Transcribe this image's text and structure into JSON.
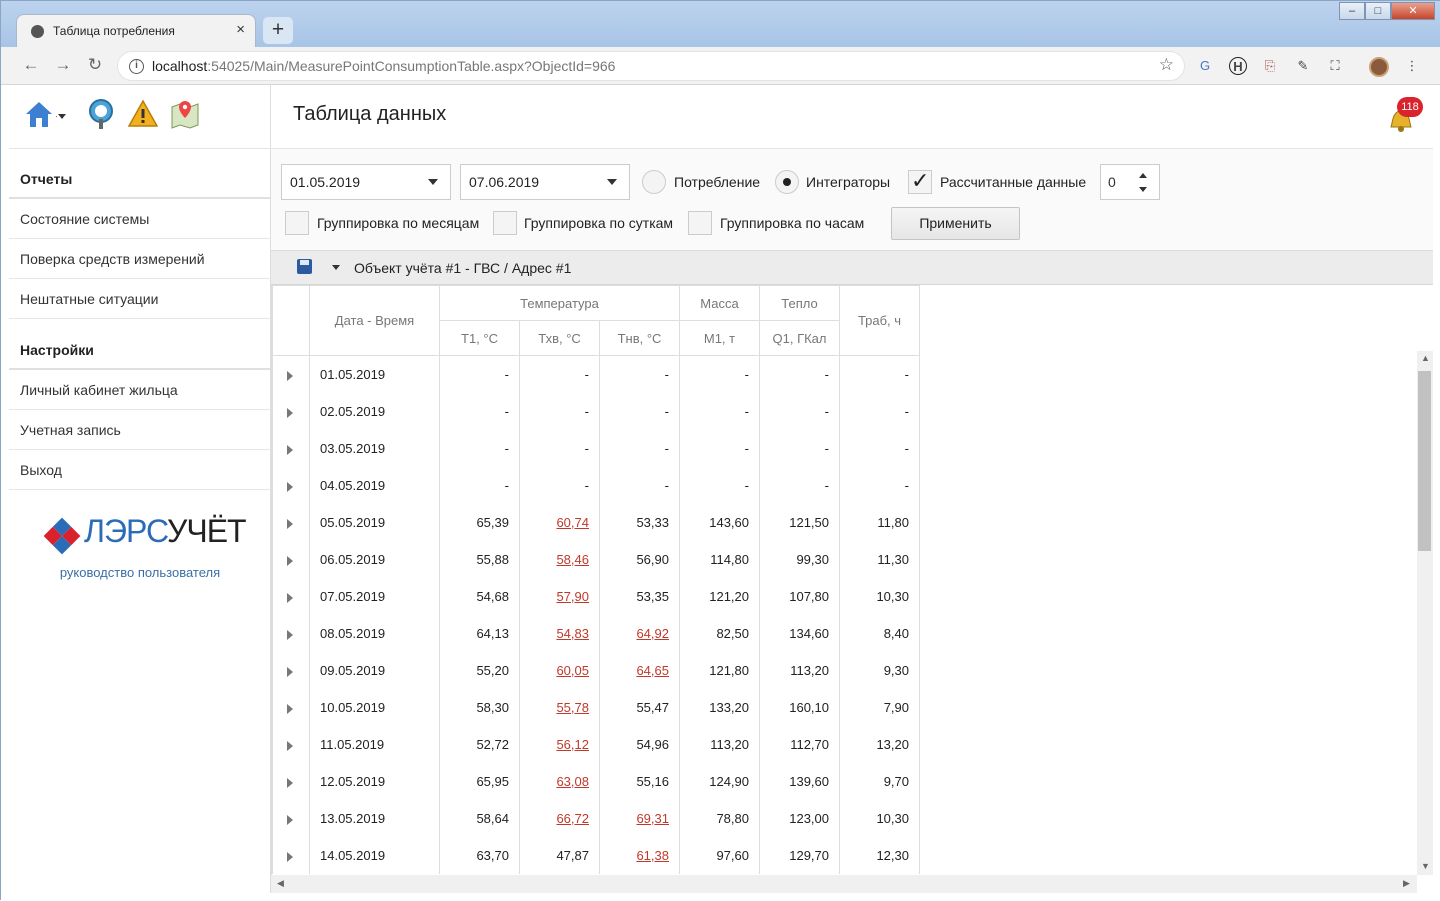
{
  "browser": {
    "tab_title": "Таблица потребления",
    "tab_close": "×",
    "new_tab": "+",
    "url_host": "localhost",
    "url_rest": ":54025/Main/MeasurePointConsumptionTable.aspx?ObjectId=966"
  },
  "sidebar": {
    "group_reports": "Отчеты",
    "reports_items": [
      "Состояние системы",
      "Поверка средств измерений",
      "Нештатные ситуации"
    ],
    "group_settings": "Настройки",
    "settings_items": [
      "Личный кабинет жильца",
      "Учетная запись",
      "Выход"
    ],
    "logo_text_a": "ЛЭРС",
    "logo_text_b": "УЧЁТ",
    "guide_link": "руководство пользователя"
  },
  "header": {
    "title": "Таблица данных",
    "notifications": "118"
  },
  "filters": {
    "date_from": "01.05.2019",
    "date_to": "07.06.2019",
    "radio_consumption": "Потребление",
    "radio_integrators": "Интеграторы",
    "calc_data": "Рассчитанные данные",
    "spin_value": "0",
    "group_months": "Группировка по месяцам",
    "group_days": "Группировка по суткам",
    "group_hours": "Группировка по часам",
    "apply": "Применить"
  },
  "grid": {
    "title": "Объект учёта #1 - ГВС / Адрес #1",
    "col_datetime": "Дата - Время",
    "grp_temperature": "Температура",
    "grp_mass": "Масса",
    "grp_heat": "Тепло",
    "col_traб": "Траб, ч",
    "col_t1": "Т1, °С",
    "col_txv": "Тхв, °С",
    "col_tnv": "Тнв, °С",
    "col_m1": "М1, т",
    "col_q1": "Q1, ГКал",
    "rows": [
      {
        "date": "01.05.2019",
        "t1": "-",
        "txv": "-",
        "tnv": "-",
        "m1": "-",
        "q1": "-",
        "trab": "-",
        "txv_warn": false,
        "tnv_warn": false
      },
      {
        "date": "02.05.2019",
        "t1": "-",
        "txv": "-",
        "tnv": "-",
        "m1": "-",
        "q1": "-",
        "trab": "-",
        "txv_warn": false,
        "tnv_warn": false
      },
      {
        "date": "03.05.2019",
        "t1": "-",
        "txv": "-",
        "tnv": "-",
        "m1": "-",
        "q1": "-",
        "trab": "-",
        "txv_warn": false,
        "tnv_warn": false
      },
      {
        "date": "04.05.2019",
        "t1": "-",
        "txv": "-",
        "tnv": "-",
        "m1": "-",
        "q1": "-",
        "trab": "-",
        "txv_warn": false,
        "tnv_warn": false
      },
      {
        "date": "05.05.2019",
        "t1": "65,39",
        "txv": "60,74",
        "tnv": "53,33",
        "m1": "143,60",
        "q1": "121,50",
        "trab": "11,80",
        "txv_warn": true,
        "tnv_warn": false
      },
      {
        "date": "06.05.2019",
        "t1": "55,88",
        "txv": "58,46",
        "tnv": "56,90",
        "m1": "114,80",
        "q1": "99,30",
        "trab": "11,30",
        "txv_warn": true,
        "tnv_warn": false
      },
      {
        "date": "07.05.2019",
        "t1": "54,68",
        "txv": "57,90",
        "tnv": "53,35",
        "m1": "121,20",
        "q1": "107,80",
        "trab": "10,30",
        "txv_warn": true,
        "tnv_warn": false
      },
      {
        "date": "08.05.2019",
        "t1": "64,13",
        "txv": "54,83",
        "tnv": "64,92",
        "m1": "82,50",
        "q1": "134,60",
        "trab": "8,40",
        "txv_warn": true,
        "tnv_warn": true
      },
      {
        "date": "09.05.2019",
        "t1": "55,20",
        "txv": "60,05",
        "tnv": "64,65",
        "m1": "121,80",
        "q1": "113,20",
        "trab": "9,30",
        "txv_warn": true,
        "tnv_warn": true
      },
      {
        "date": "10.05.2019",
        "t1": "58,30",
        "txv": "55,78",
        "tnv": "55,47",
        "m1": "133,20",
        "q1": "160,10",
        "trab": "7,90",
        "txv_warn": true,
        "tnv_warn": false
      },
      {
        "date": "11.05.2019",
        "t1": "52,72",
        "txv": "56,12",
        "tnv": "54,96",
        "m1": "113,20",
        "q1": "112,70",
        "trab": "13,20",
        "txv_warn": true,
        "tnv_warn": false
      },
      {
        "date": "12.05.2019",
        "t1": "65,95",
        "txv": "63,08",
        "tnv": "55,16",
        "m1": "124,90",
        "q1": "139,60",
        "trab": "9,70",
        "txv_warn": true,
        "tnv_warn": false
      },
      {
        "date": "13.05.2019",
        "t1": "58,64",
        "txv": "66,72",
        "tnv": "69,31",
        "m1": "78,80",
        "q1": "123,00",
        "trab": "10,30",
        "txv_warn": true,
        "tnv_warn": true
      },
      {
        "date": "14.05.2019",
        "t1": "63,70",
        "txv": "47,87",
        "tnv": "61,38",
        "m1": "97,60",
        "q1": "129,70",
        "trab": "12,30",
        "txv_warn": false,
        "tnv_warn": true
      }
    ]
  },
  "colors": {
    "accent": "#3a6ea5",
    "warn": "#c0392b",
    "badge": "#d9232d"
  }
}
